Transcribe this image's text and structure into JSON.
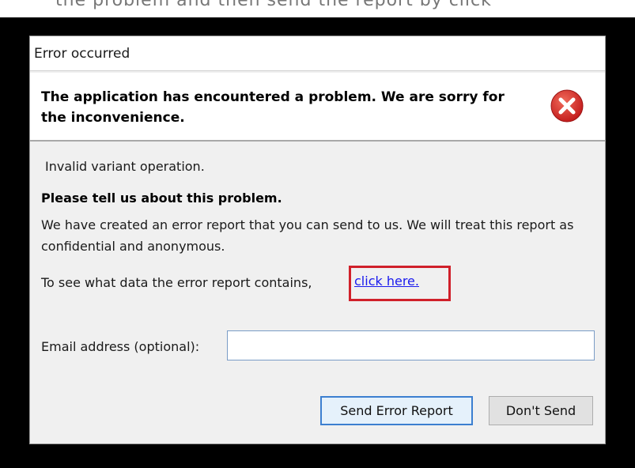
{
  "backdrop": {
    "top_strip_text": "the problem and then send the report by click"
  },
  "dialog": {
    "title": "Error occurred",
    "header_message": "The application has encountered a problem. We are sorry for the inconvenience.",
    "error_icon": "error-circle-x-icon",
    "error_detail": "Invalid variant operation.",
    "prompt_title": "Please tell us about this problem.",
    "prompt_body": "We have created an error report that you can send to us. We will treat this report as confidential and anonymous.",
    "view_report_text": "To see what data the error report contains,",
    "view_report_link": "click here.",
    "email_label": "Email address (optional):",
    "email_value": "",
    "send_button": "Send Error Report",
    "dont_send_button": "Don't Send"
  },
  "colors": {
    "backdrop": "#000000",
    "dialog_bg": "#f0f0f0",
    "highlight_box": "#d0202a",
    "link": "#1a1aee",
    "error_icon": "#d42a2a"
  }
}
